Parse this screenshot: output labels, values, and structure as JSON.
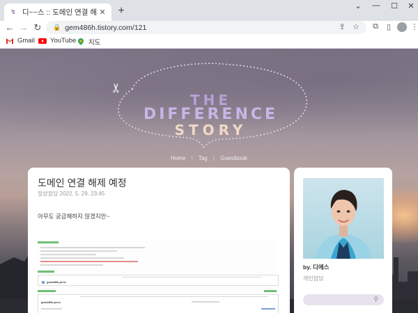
{
  "browser": {
    "tab_title": "디~~스 :: 도메인 연결 해제 예정",
    "favicon": "↯",
    "tab_close": "✕",
    "new_tab": "+",
    "window_controls": {
      "chevron": "⌄",
      "minimize": "—",
      "maximize": "☐",
      "close": "✕"
    },
    "nav": {
      "back": "←",
      "forward": "→",
      "reload": "↻"
    },
    "lock": "🔒",
    "url": "gem486h.tistory.com/121",
    "bookmarks": [
      {
        "label": "Gmail",
        "color": "#d93025"
      },
      {
        "label": "YouTube",
        "color": "#ff0000"
      },
      {
        "label": "지도",
        "color": "#34a853"
      }
    ]
  },
  "blog": {
    "logo": {
      "line1": "THE",
      "line2": "DIFFERENCE",
      "line3": "STORY"
    },
    "nav": [
      "Home",
      "Tag",
      "Guestbook"
    ],
    "nav_sep": "|"
  },
  "post": {
    "title": "도메인 연결 해제 예정",
    "meta": "일상잡담 2022. 5. 29. 23:45",
    "body": "아무도 궁금해하지 않겠지만~",
    "shot": {
      "label1": "gem486h.pe.kr",
      "label2": "gem486h.pe.kr"
    }
  },
  "sidebar": {
    "by": "by.",
    "name": "디에스",
    "desc": "개인잡담",
    "search_icon": "⚲"
  },
  "colors": {
    "accent": "#c8b6e6",
    "card": "#ffffff"
  }
}
